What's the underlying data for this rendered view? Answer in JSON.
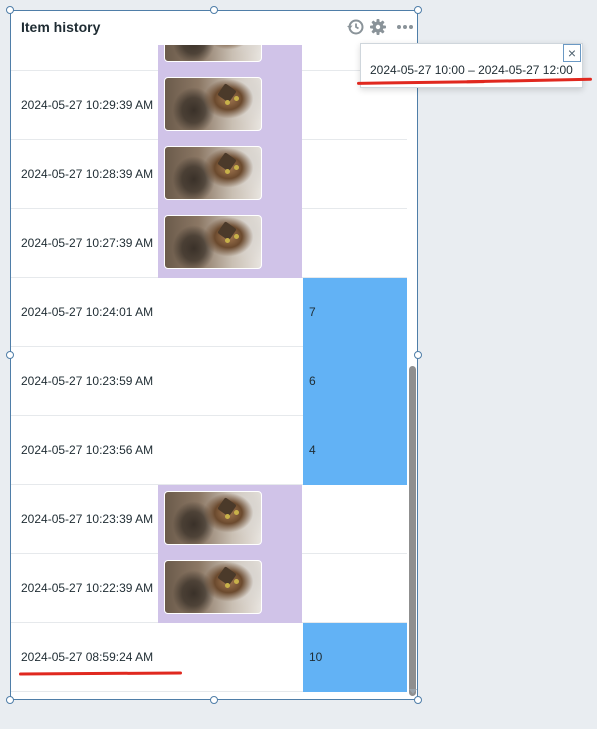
{
  "widget": {
    "title": "Item history",
    "header_icons": [
      "history-icon",
      "gear-icon",
      "more-icon"
    ]
  },
  "rows": [
    {
      "timestamp": "",
      "type": "image"
    },
    {
      "timestamp": "2024-05-27 10:29:39 AM",
      "type": "image"
    },
    {
      "timestamp": "2024-05-27 10:28:39 AM",
      "type": "image"
    },
    {
      "timestamp": "2024-05-27 10:27:39 AM",
      "type": "image"
    },
    {
      "timestamp": "2024-05-27 10:24:01 AM",
      "type": "number",
      "value": "7"
    },
    {
      "timestamp": "2024-05-27 10:23:59 AM",
      "type": "number",
      "value": "6"
    },
    {
      "timestamp": "2024-05-27 10:23:56 AM",
      "type": "number",
      "value": "4"
    },
    {
      "timestamp": "2024-05-27 10:23:39 AM",
      "type": "image"
    },
    {
      "timestamp": "2024-05-27 10:22:39 AM",
      "type": "image"
    },
    {
      "timestamp": "2024-05-27 08:59:24 AM",
      "type": "number",
      "value": "10"
    }
  ],
  "tooltip": {
    "text": "2024-05-27 10:00 – 2024-05-27 12:00",
    "close_label": "×"
  },
  "colors": {
    "image_cell": "#d0c3e8",
    "number_cell": "#62b2f5",
    "annotation": "#e0281f",
    "selection_border": "#4f7ea8"
  }
}
